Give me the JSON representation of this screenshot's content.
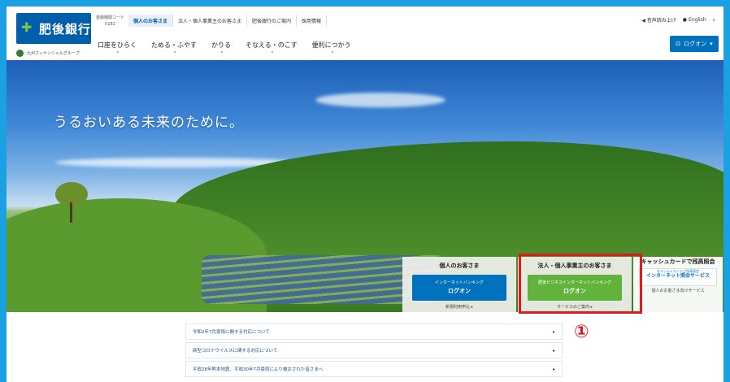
{
  "header": {
    "logo_text": "肥後銀行",
    "group_label": "九州フィナンシャルグループ",
    "bank_code_label": "金融機関コード",
    "bank_code": "0182",
    "top_tabs": [
      "個人のお客さま",
      "法人・個人事業主のお客さま",
      "肥後銀行のご案内",
      "採用情報"
    ],
    "read_aloud": "音声読み上げ",
    "english": "English",
    "nav": [
      "口座をひらく",
      "ためる・ふやす",
      "かりる",
      "そなえる・のこす",
      "便利につかう"
    ],
    "logon_label": "ログオン"
  },
  "hero": {
    "title": "うるおいある未来のために。"
  },
  "panels": {
    "personal": {
      "title": "個人のお客さま",
      "btn_line1": "インターネットバンキング",
      "btn_line2": "ログオン",
      "link": "新規利用申込 ▸"
    },
    "business": {
      "title": "法人・個人事業主のお客さま",
      "btn_line1": "肥後ビジネスインターネットバンキング",
      "btn_line2": "ログオン",
      "link": "サービスのご案内 ▸"
    },
    "cash": {
      "title": "キャッシュカードで残高照会",
      "btn_line1": "キャッシュカードで残高照会",
      "btn_line2": "インターネット照会サービス",
      "link": "個人のお客さま向けサービス"
    }
  },
  "news": [
    "令和2年7月豪雨に関する対応について",
    "新型コロナウイルスに関する対応について",
    "平成28年熊本地震、平成30年7月豪雨により被災された皆さまへ"
  ],
  "annotation": "①"
}
